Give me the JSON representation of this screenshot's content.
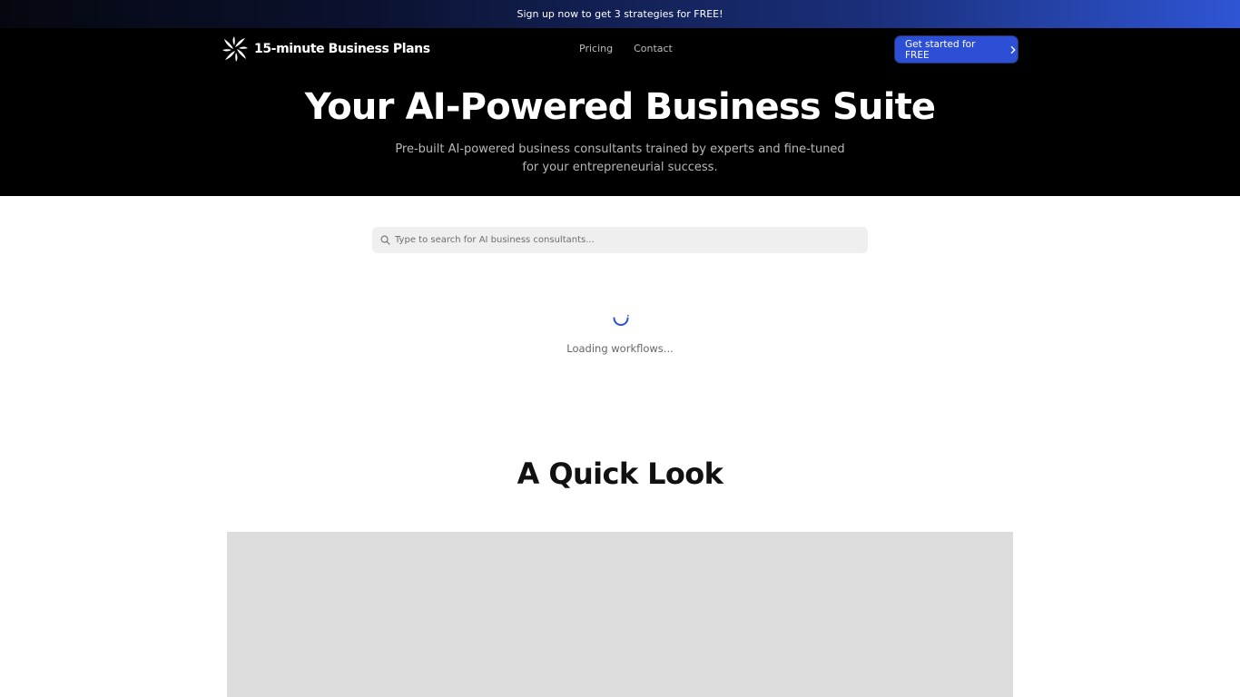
{
  "promo": {
    "text": "Sign up now to get 3 strategies for FREE!"
  },
  "nav": {
    "logo_text": "15-minute Business Plans",
    "logo_icon": "pinwheel-logo-icon",
    "links": [
      {
        "label": "Pricing"
      },
      {
        "label": "Contact"
      }
    ],
    "cta_label": "Get started for FREE",
    "cta_icon": "chevron-right-icon"
  },
  "hero": {
    "title": "Your AI-Powered Business Suite",
    "subtitle": "Pre-built AI-powered business consultants trained by experts and fine-tuned for your entrepreneurial success."
  },
  "search": {
    "value": "",
    "placeholder": "Type to search for AI business consultants...",
    "icon": "search-icon"
  },
  "loading": {
    "text": "Loading workflows...",
    "icon": "spinner-icon"
  },
  "quick_look": {
    "title": "A Quick Look"
  },
  "colors": {
    "accent": "#2d4fd6",
    "hero_bg": "#000000",
    "placeholder_bg": "#dcdcdc"
  }
}
